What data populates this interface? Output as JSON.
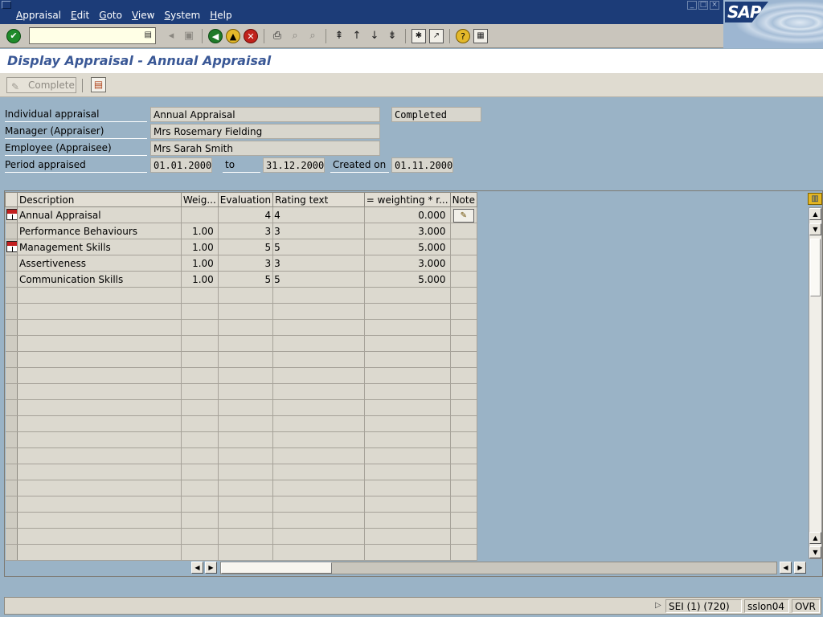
{
  "menubar": {
    "items": [
      "Appraisal",
      "Edit",
      "Goto",
      "View",
      "System",
      "Help"
    ],
    "window_buttons": [
      "_",
      "□",
      "×"
    ],
    "logo": "SAP"
  },
  "toolbar": {
    "command_value": "",
    "icons": [
      "enter-icon",
      "back-icon",
      "exit-icon",
      "cancel-icon",
      "print-icon",
      "find-icon",
      "find-next-icon",
      "first-page-icon",
      "previous-page-icon",
      "next-page-icon",
      "last-page-icon",
      "create-session-icon",
      "shortcut-icon",
      "help-icon",
      "layout-menu-icon"
    ]
  },
  "page_title": "Display Appraisal - Annual Appraisal",
  "app_toolbar": {
    "complete_label": "Complete"
  },
  "header": {
    "individual_appraisal_label": "Individual appraisal",
    "individual_appraisal_value": "Annual Appraisal",
    "status_value": "Completed",
    "manager_label": "Manager (Appraiser)",
    "manager_value": "Mrs Rosemary Fielding",
    "employee_label": "Employee (Appraisee)",
    "employee_value": "Mrs Sarah Smith",
    "period_label": "Period appraised",
    "period_from": "01.01.2000",
    "to_label": "to",
    "period_to": "31.12.2000",
    "created_label": "Created on",
    "created_value": "01.11.2000"
  },
  "table": {
    "columns": [
      "Description",
      "Weig...",
      "Evaluation",
      "Rating text",
      "= weighting  * r...",
      "Note"
    ],
    "rows": [
      {
        "description": "Annual Appraisal",
        "weight": "",
        "evaluation": "4",
        "rating_text": "4",
        "weighted": "0.000",
        "has_hierarchy": true,
        "has_note": true
      },
      {
        "description": "Performance Behaviours",
        "weight": "1.00",
        "evaluation": "3",
        "rating_text": "3",
        "weighted": "3.000",
        "has_hierarchy": false,
        "has_note": false
      },
      {
        "description": "Management Skills",
        "weight": "1.00",
        "evaluation": "5",
        "rating_text": "5",
        "weighted": "5.000",
        "has_hierarchy": true,
        "has_note": false
      },
      {
        "description": "Assertiveness",
        "weight": "1.00",
        "evaluation": "3",
        "rating_text": "3",
        "weighted": "3.000",
        "has_hierarchy": false,
        "has_note": false
      },
      {
        "description": "Communication Skills",
        "weight": "1.00",
        "evaluation": "5",
        "rating_text": "5",
        "weighted": "5.000",
        "has_hierarchy": false,
        "has_note": false
      }
    ],
    "empty_rows": 17
  },
  "statusbar": {
    "system": "SEI (1) (720)",
    "server": "sslon04",
    "mode": "OVR"
  }
}
